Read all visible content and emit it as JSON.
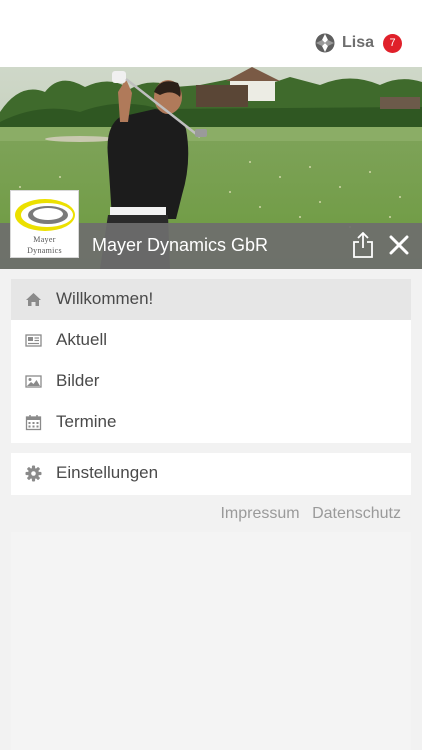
{
  "header": {
    "user_name": "Lisa",
    "notification_count": "7"
  },
  "hero": {
    "company_name": "Mayer Dynamics GbR",
    "logo_lines": [
      "Mayer",
      "Dynamics"
    ]
  },
  "menu": {
    "main_items": [
      {
        "label": "Willkommen!",
        "icon": "home-icon",
        "active": true
      },
      {
        "label": "Aktuell",
        "icon": "newspaper-icon",
        "active": false
      },
      {
        "label": "Bilder",
        "icon": "image-icon",
        "active": false
      },
      {
        "label": "Termine",
        "icon": "calendar-icon",
        "active": false
      }
    ],
    "secondary_items": [
      {
        "label": "Einstellungen",
        "icon": "gear-icon"
      }
    ]
  },
  "footer": {
    "impressum": "Impressum",
    "datenschutz": "Datenschutz"
  },
  "colors": {
    "badge": "#e0202a",
    "title_bar": "#6e6e6e",
    "active_item": "#e6e6e6"
  }
}
